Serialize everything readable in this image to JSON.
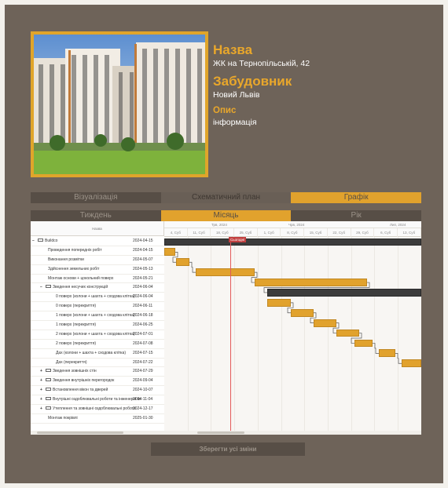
{
  "project": {
    "name_label": "Назва",
    "name_value": "ЖК на Тернопільській, 42",
    "developer_label": "Забудовник",
    "developer_value": "Новий Львів",
    "description_label": "Опис",
    "description_value": "інформація"
  },
  "view_tabs": [
    {
      "label": "Візуалізація",
      "active": false
    },
    {
      "label": "Схематичний план",
      "active": false
    },
    {
      "label": "Графік",
      "active": true
    }
  ],
  "scale_tabs": [
    {
      "label": "Тиждень",
      "active": false
    },
    {
      "label": "Місяць",
      "active": true
    },
    {
      "label": "Рік",
      "active": false
    }
  ],
  "gantt": {
    "grid_header": "Назва",
    "today_label": "Сьогодні",
    "months": [
      {
        "label": "Трв, 2024"
      },
      {
        "label": "Чрв, 2024"
      },
      {
        "label": "Лип, 2024"
      }
    ],
    "weeks": [
      "4, Суб",
      "11, Суб",
      "18, Суб",
      "25, Суб",
      "1, Суб",
      "8, Суб",
      "15, Суб",
      "22, Суб",
      "29, Суб",
      "6, Суб",
      "13, Суб"
    ],
    "rows": [
      {
        "toggle": "−",
        "folder": true,
        "name": "Buildco",
        "date": "2024-04-15",
        "level": 0
      },
      {
        "toggle": "",
        "folder": false,
        "name": "Проведення попередніх робіт",
        "date": "2024-04-15",
        "level": 2
      },
      {
        "toggle": "",
        "folder": false,
        "name": "Виконання розмітки",
        "date": "2024-05-07",
        "level": 2
      },
      {
        "toggle": "",
        "folder": false,
        "name": "Здійснення земельних робіт",
        "date": "2024-05-13",
        "level": 2
      },
      {
        "toggle": "",
        "folder": false,
        "name": "Монтаж основи + цокольний поверх",
        "date": "2024-05-21",
        "level": 2
      },
      {
        "toggle": "−",
        "folder": true,
        "name": "Зведення несучих конструкцій",
        "date": "2024-06-04",
        "level": 1
      },
      {
        "toggle": "",
        "folder": false,
        "name": "0 поверх (колони + шахта + сходова клітка)",
        "date": "2024-06-04",
        "level": 3
      },
      {
        "toggle": "",
        "folder": false,
        "name": "0 поверх (перекриття)",
        "date": "2024-06-11",
        "level": 3
      },
      {
        "toggle": "",
        "folder": false,
        "name": "1 поверх (колони + шахта + сходова клітка)",
        "date": "2024-06-18",
        "level": 3
      },
      {
        "toggle": "",
        "folder": false,
        "name": "1 поверх (перекриття)",
        "date": "2024-06-25",
        "level": 3
      },
      {
        "toggle": "",
        "folder": false,
        "name": "2 поверх (колони + шахта + сходова клітка)",
        "date": "2024-07-01",
        "level": 3
      },
      {
        "toggle": "",
        "folder": false,
        "name": "2 поверх (перекриття)",
        "date": "2024-07-08",
        "level": 3
      },
      {
        "toggle": "",
        "folder": false,
        "name": "Дах (колони + шахта + сходова клітка)",
        "date": "2024-07-15",
        "level": 3
      },
      {
        "toggle": "",
        "folder": false,
        "name": "Дах (перекриття)",
        "date": "2024-07-22",
        "level": 3
      },
      {
        "toggle": "+",
        "folder": true,
        "name": "Зведення зовнішніх стін",
        "date": "2024-07-29",
        "level": 1
      },
      {
        "toggle": "+",
        "folder": true,
        "name": "Зведення внутрішніх перегородок",
        "date": "2024-09-04",
        "level": 1
      },
      {
        "toggle": "+",
        "folder": true,
        "name": "Встановлення вікон та дверей",
        "date": "2024-10-07",
        "level": 1
      },
      {
        "toggle": "+",
        "folder": true,
        "name": "Внутрішні оздоблювальні роботи та інженерні мережі",
        "date": "2024-11-04",
        "level": 1
      },
      {
        "toggle": "+",
        "folder": true,
        "name": "Утеплення та зовнішні оздоблювальні роботи",
        "date": "2024-12-17",
        "level": 1
      },
      {
        "toggle": "",
        "folder": false,
        "name": "Монтаж покрівлі",
        "date": "2025-01-30",
        "level": 2
      }
    ]
  },
  "save_button": "Зберегти усі зміни",
  "colors": {
    "accent": "#e1a22d",
    "frame_bg": "#6e6359",
    "today_line": "#e35a5a"
  }
}
